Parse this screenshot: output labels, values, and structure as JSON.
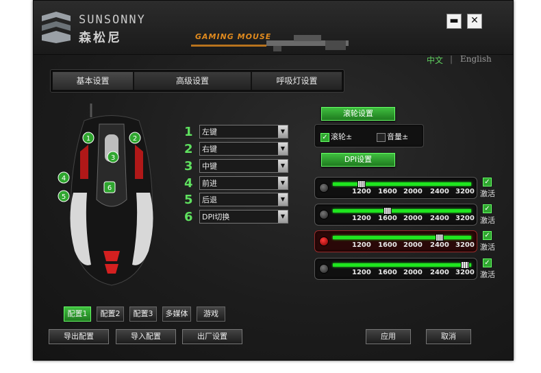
{
  "brand": {
    "name_en": "SUNSONNY",
    "name_cn": "森松尼",
    "tagline": "GAMING MOUSE"
  },
  "window_controls": {
    "minimize": "▬",
    "close": "✕"
  },
  "language": {
    "chinese": "中文",
    "separator": "|",
    "english": "English"
  },
  "tabs": [
    "基本设置",
    "高级设置",
    "呼吸灯设置"
  ],
  "mouse_callouts": [
    "1",
    "2",
    "3",
    "4",
    "5",
    "6"
  ],
  "buttons": [
    {
      "number": "1",
      "value": "左键"
    },
    {
      "number": "2",
      "value": "右键"
    },
    {
      "number": "3",
      "value": "中键"
    },
    {
      "number": "4",
      "value": "前进"
    },
    {
      "number": "5",
      "value": "后退"
    },
    {
      "number": "6",
      "value": "DPI切换"
    }
  ],
  "wheel": {
    "header": "滚轮设置",
    "options": [
      {
        "label": "滚轮±",
        "checked": true
      },
      {
        "label": "音量±",
        "checked": false
      }
    ]
  },
  "dpi": {
    "header": "DPI设置",
    "ticks": [
      "1200",
      "1600",
      "2000",
      "2400",
      "3200"
    ],
    "levels": [
      {
        "value": 1200,
        "selected": false,
        "activated": true,
        "activate_label": "激活"
      },
      {
        "value": 1600,
        "selected": false,
        "activated": true,
        "activate_label": "激活"
      },
      {
        "value": 2400,
        "selected": true,
        "activated": true,
        "activate_label": "激活"
      },
      {
        "value": 3200,
        "selected": false,
        "activated": true,
        "activate_label": "激活"
      }
    ]
  },
  "profiles": [
    "配置1",
    "配置2",
    "配置3",
    "多媒体",
    "游戏"
  ],
  "actions": {
    "export": "导出配置",
    "import": "导入配置",
    "factory": "出厂设置",
    "apply": "应用",
    "cancel": "取消"
  },
  "colors": {
    "accent_green": "#2fa62f",
    "bright_green": "#1fe61f",
    "lang_active": "#5fd05f",
    "lang_inactive": "#9a9a9a",
    "tagline_orange": "#e08a1e"
  }
}
